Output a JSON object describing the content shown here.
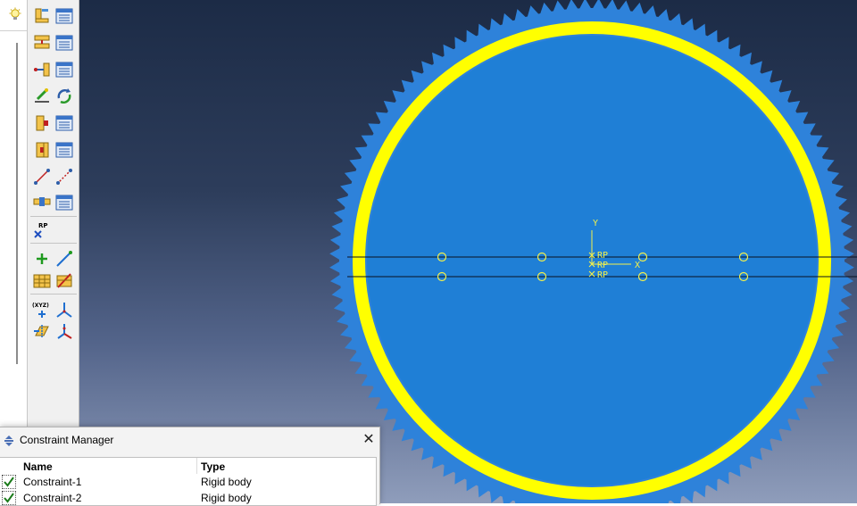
{
  "tree": {
    "hint_icon": "lightbulb-icon"
  },
  "toolbox": {
    "tools": [
      {
        "name": "create-constraint-icon"
      },
      {
        "name": "constraint-manager-icon"
      },
      {
        "name": "create-connector-section-icon"
      },
      {
        "name": "connector-section-manager-icon"
      },
      {
        "name": "create-wire-icon"
      },
      {
        "name": "wire-manager-icon"
      },
      {
        "name": "create-connector-assignment-icon"
      },
      {
        "name": "connector-assignment-switch-icon"
      },
      {
        "name": "create-engineering-feature-icon"
      },
      {
        "name": "engineering-feature-manager-icon"
      },
      {
        "name": "create-interaction-icon"
      },
      {
        "name": "interaction-manager-icon"
      },
      {
        "name": "create-spring-icon"
      },
      {
        "name": "create-dashpot-icon"
      },
      {
        "name": "create-display-body-icon"
      },
      {
        "name": "display-body-manager-icon"
      },
      {
        "name": "reference-point-icon",
        "label": "RP"
      },
      {
        "name": "create-datum-point-icon"
      },
      {
        "name": "create-datum-axis-icon"
      },
      {
        "name": "create-datum-plane-icon"
      },
      {
        "name": "partition-cell-icon"
      },
      {
        "name": "datum-csys-icon",
        "label": "(XYZ)"
      },
      {
        "name": "datum-csys-axes-icon"
      },
      {
        "name": "datum-plane-offset-icon"
      },
      {
        "name": "datum-csys-rectangular-icon"
      }
    ]
  },
  "viewport": {
    "background_top": "#1c2b46",
    "background_bottom": "#8f9dbb",
    "gear_color": "#2e82da",
    "rim_color": "#ffff00",
    "hole_color": "#f4f14a",
    "axis_y_label": "Y",
    "axis_x_label": "X",
    "rp_labels": [
      "RP",
      "RP",
      "RP"
    ]
  },
  "constraint_manager": {
    "title": "Constraint Manager",
    "close_symbol": "✕",
    "columns": [
      "Name",
      "Type"
    ],
    "rows": [
      {
        "name": "Constraint-1",
        "type": "Rigid body",
        "active": true
      },
      {
        "name": "Constraint-2",
        "type": "Rigid body",
        "active": true
      }
    ]
  }
}
